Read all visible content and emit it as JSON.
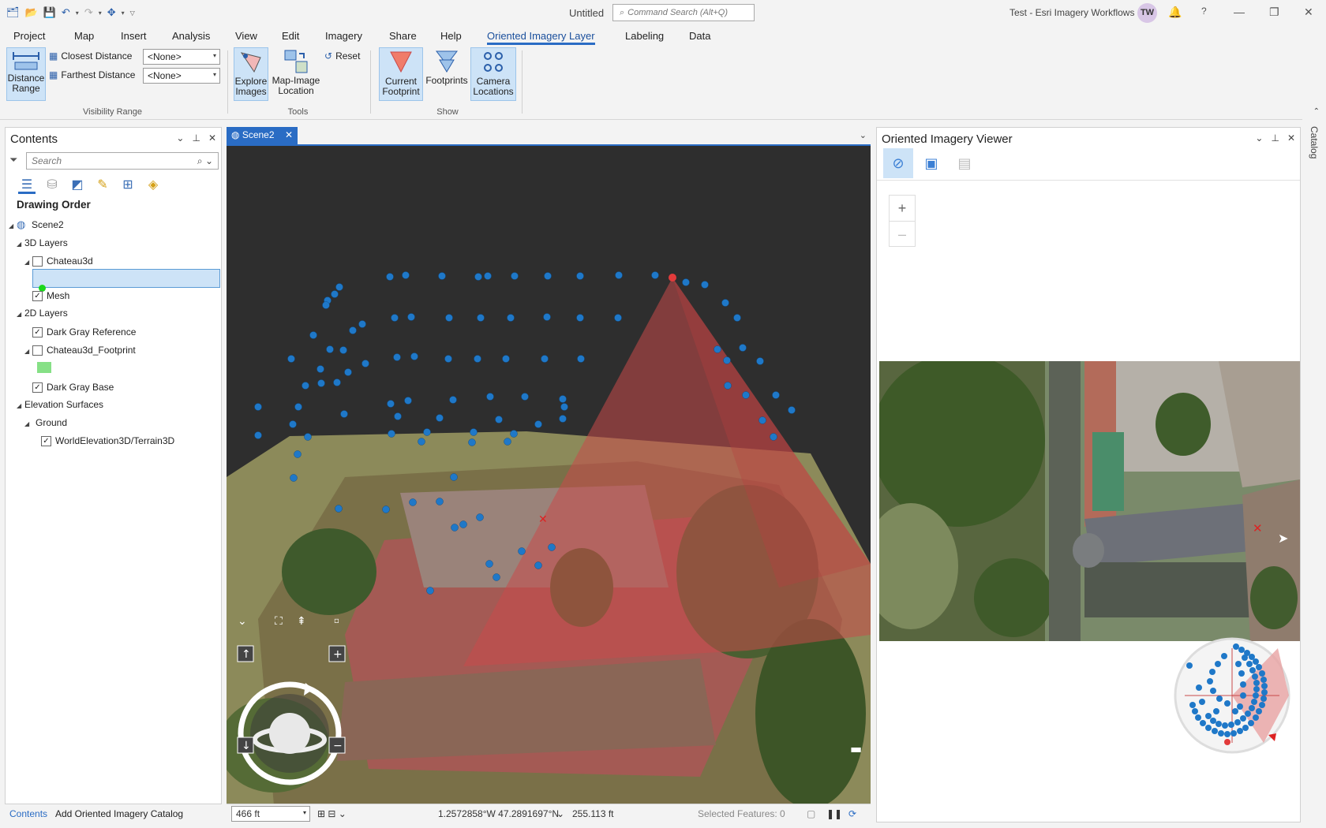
{
  "titlebar": {
    "doc_title": "Untitled",
    "search_placeholder": "Command Search (Alt+Q)",
    "app_title": "Test - Esri Imagery Workflows",
    "user_initials": "TW",
    "help": "?"
  },
  "menu": {
    "items": [
      "Project",
      "Map",
      "Insert",
      "Analysis",
      "View",
      "Edit",
      "Imagery",
      "Share",
      "Help",
      "Oriented Imagery Layer",
      "Labeling",
      "Data"
    ],
    "active_index": 9
  },
  "ribbon": {
    "visibility_range": {
      "distance_range_line1": "Distance",
      "distance_range_line2": "Range",
      "closest_label": "Closest Distance",
      "closest_value": "<None>",
      "farthest_label": "Farthest Distance",
      "farthest_value": "<None>",
      "group_label": "Visibility Range"
    },
    "tools": {
      "explore_line1": "Explore",
      "explore_line2": "Images",
      "mapimage_line1": "Map-Image",
      "mapimage_line2": "Location",
      "reset": "Reset",
      "group_label": "Tools"
    },
    "show": {
      "current_footprint_line1": "Current",
      "current_footprint_line2": "Footprint",
      "footprints": "Footprints",
      "camera_locations_line1": "Camera",
      "camera_locations_line2": "Locations",
      "group_label": "Show"
    }
  },
  "contents": {
    "title": "Contents",
    "search_placeholder": "Search",
    "drawing_order": "Drawing Order",
    "items": {
      "scene": "Scene2",
      "layers3d": "3D Layers",
      "chateau3d": "Chateau3d",
      "mesh": "Mesh",
      "layers2d": "2D Layers",
      "dark_gray_ref": "Dark Gray Reference",
      "footprint": "Chateau3d_Footprint",
      "dark_gray_base": "Dark Gray Base",
      "elevation": "Elevation Surfaces",
      "ground": "Ground",
      "world_elev": "WorldElevation3D/Terrain3D"
    },
    "checked": {
      "chateau3d": false,
      "mesh": true,
      "dark_gray_ref": true,
      "footprint": false,
      "dark_gray_base": true,
      "world_elev": true
    },
    "bottom_tabs": [
      "Contents",
      "Add Oriented Imagery Catalog"
    ]
  },
  "scene": {
    "tab_label": "Scene2",
    "scale": "466 ft",
    "coordinates": "1.2572858°W 47.2891697°N",
    "elevation": "255.113 ft",
    "selected_features": "Selected Features: 0"
  },
  "oiv": {
    "title": "Oriented Imagery Viewer",
    "zoom_in": "+",
    "zoom_out": "–"
  },
  "catalog_strip": "Catalog",
  "colors": {
    "accent": "#2a6cc4",
    "footprint_red": "#c94a4a",
    "camera_blue": "#1f78c8",
    "selection": "#cde3f7"
  }
}
